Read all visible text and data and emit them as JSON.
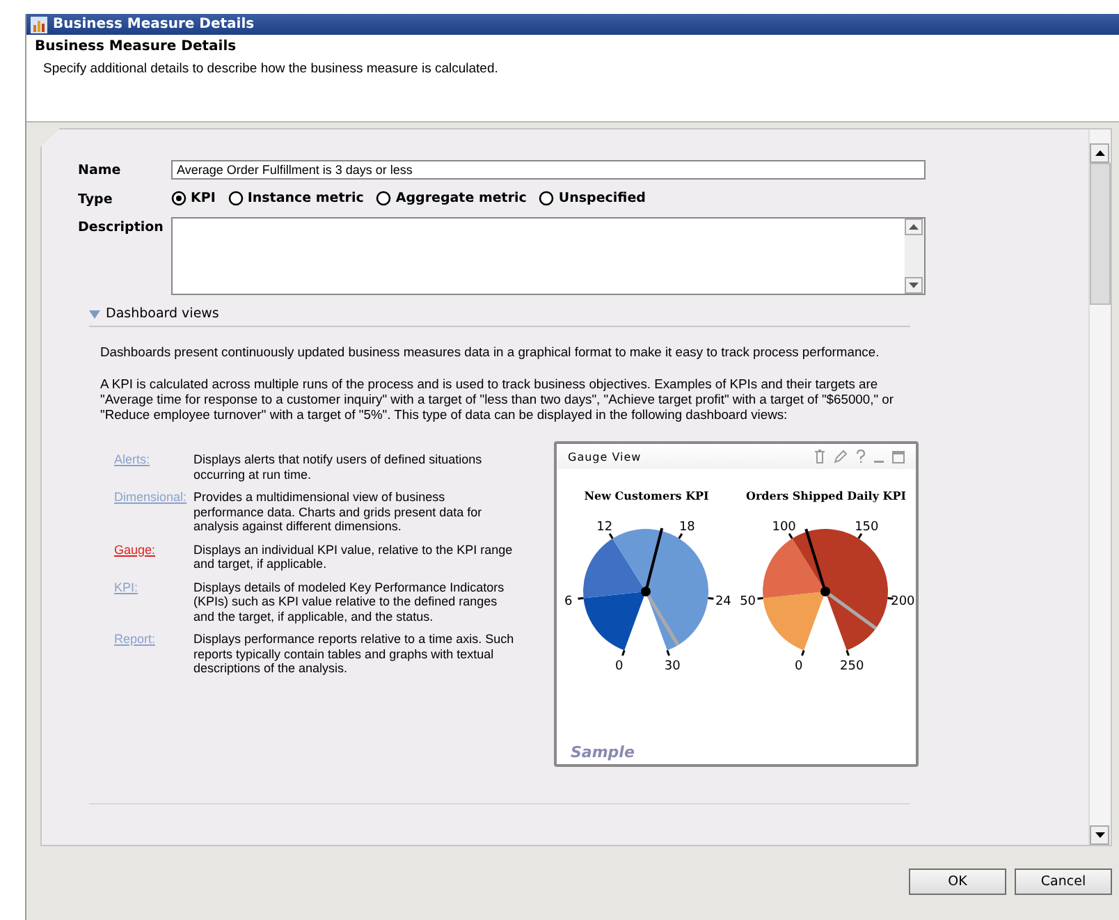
{
  "window": {
    "title": "Business Measure Details"
  },
  "header": {
    "title": "Business Measure Details",
    "subtitle": "Specify additional details to describe how the business measure is calculated."
  },
  "form": {
    "name_label": "Name",
    "name_value": "Average Order Fulfillment is 3 days or less",
    "type_label": "Type",
    "description_label": "Description",
    "types": [
      {
        "label": "KPI",
        "selected": true
      },
      {
        "label": "Instance metric",
        "selected": false
      },
      {
        "label": "Aggregate metric",
        "selected": false
      },
      {
        "label": "Unspecified",
        "selected": false
      }
    ]
  },
  "dashboard": {
    "label": "Dashboard views",
    "expanded": true,
    "intro": "Dashboards present continuously updated business measures data in a graphical format to make it easy to track process performance.",
    "kpi_text": "A KPI is calculated across multiple runs of the process and is used to track business objectives. Examples of KPIs and their targets are \"Average time for response to a customer inquiry\" with a target of \"less than two days\", \"Achieve target profit\" with a target of \"$65000,\" or \"Reduce employee turnover\" with a target of \"5%\". This type of data can be displayed in the following dashboard views:",
    "views": [
      {
        "link": "Alerts:",
        "description": "Displays alerts that notify users of defined situations occurring at run time.",
        "selected": false
      },
      {
        "link": "Dimensional:",
        "description": "Provides a multidimensional view of business performance data. Charts and grids present data for analysis against different dimensions.",
        "selected": false
      },
      {
        "link": "Gauge:",
        "description": "Displays an individual KPI value, relative to the KPI range and target, if applicable.",
        "selected": true
      },
      {
        "link": "KPI:",
        "description": "Displays details of modeled Key Performance Indicators (KPIs)  such as KPI value relative to the defined ranges and the target, if applicable, and the status.",
        "selected": false
      },
      {
        "link": "Report:",
        "description": "Displays performance reports relative to a time axis. Such reports typically contain tables and graphs with textual descriptions of the analysis.",
        "selected": false
      }
    ],
    "preview": {
      "title": "Gauge View",
      "caption": "Sample",
      "gauges": [
        {
          "title": "New Customers KPI",
          "ticks": [
            "0",
            "6",
            "12",
            "18",
            "24",
            "30"
          ]
        },
        {
          "title": "Orders Shipped Daily KPI",
          "ticks": [
            "0",
            "50",
            "100",
            "150",
            "200",
            "250"
          ]
        }
      ]
    }
  },
  "buttons": [
    "OK",
    "Cancel"
  ]
}
